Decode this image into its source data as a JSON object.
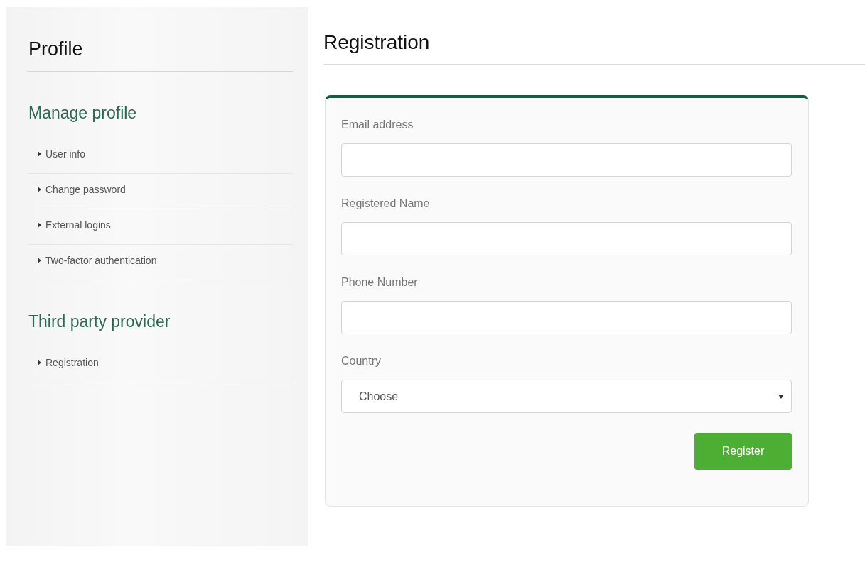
{
  "sidebar": {
    "title": "Profile",
    "sections": [
      {
        "heading": "Manage profile",
        "items": [
          {
            "label": "User info"
          },
          {
            "label": "Change password"
          },
          {
            "label": "External logins"
          },
          {
            "label": "Two-factor authentication"
          }
        ]
      },
      {
        "heading": "Third party provider",
        "items": [
          {
            "label": "Registration"
          }
        ]
      }
    ]
  },
  "main": {
    "title": "Registration",
    "form": {
      "fields": [
        {
          "kind": "text",
          "label": "Email address"
        },
        {
          "kind": "text",
          "label": "Registered Name"
        },
        {
          "kind": "text",
          "label": "Phone Number"
        },
        {
          "kind": "select",
          "label": "Country",
          "value": "Choose"
        }
      ],
      "submit": "Register"
    }
  }
}
